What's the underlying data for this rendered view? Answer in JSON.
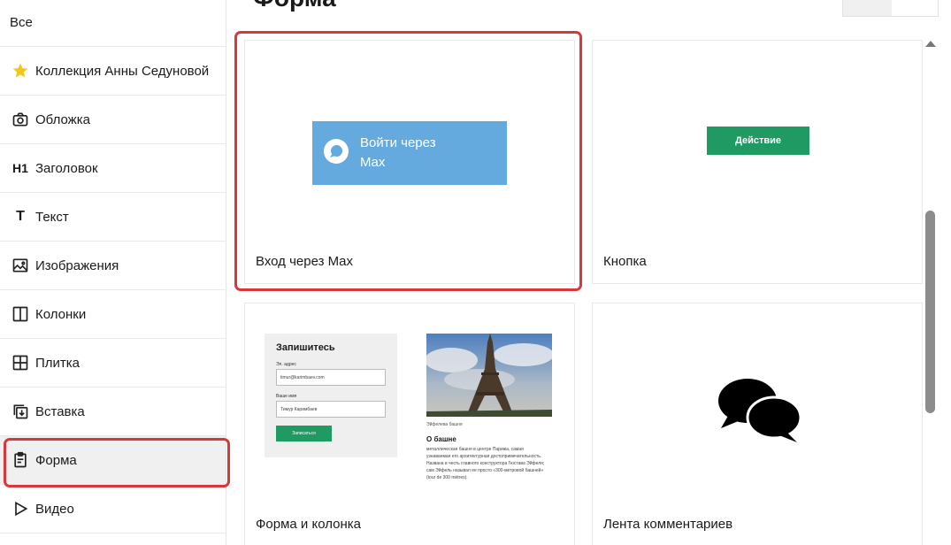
{
  "sidebar": {
    "items": [
      {
        "label": "Все",
        "icon": "none"
      },
      {
        "label": "Коллекция Анны Седуновой",
        "icon": "star-icon"
      },
      {
        "label": "Обложка",
        "icon": "camera-icon"
      },
      {
        "label": "Заголовок",
        "icon": "heading-h1-icon",
        "icon_text": "H1"
      },
      {
        "label": "Текст",
        "icon": "text-icon",
        "icon_text": "T"
      },
      {
        "label": "Изображения",
        "icon": "image-icon"
      },
      {
        "label": "Колонки",
        "icon": "columns-icon"
      },
      {
        "label": "Плитка",
        "icon": "grid-icon"
      },
      {
        "label": "Вставка",
        "icon": "embed-icon"
      },
      {
        "label": "Форма",
        "icon": "form-clipboard-icon"
      },
      {
        "label": "Видео",
        "icon": "play-icon"
      }
    ],
    "active_index": 9
  },
  "main": {
    "title": "Форма",
    "cards": [
      {
        "label": "Вход через Max",
        "preview_button_text_line1": "Войти через",
        "preview_button_text_line2": "Max"
      },
      {
        "label": "Кнопка",
        "preview_button_text": "Действие"
      },
      {
        "label": "Форма и колонка"
      },
      {
        "label": "Лента комментариев"
      }
    ]
  },
  "form_preview": {
    "title": "Запишитесь",
    "email_label": "Эл. адрес",
    "email_value": "timur@karimbaev.com",
    "name_label": "Ваше имя",
    "name_value": "Тимур Каримбаев",
    "submit": "Записаться",
    "photo_caption": "Эйфелева башня",
    "about_title": "О башне",
    "about_text": "металлическая башня в центре Парижа, самая узнаваемая его архитектурная достопримечательность. Названа в честь главного конструктора Гюстава Эйфеля; сам Эйфель называл ее просто «300-метровой башней» (tour de 300 mètres)."
  },
  "colors": {
    "accent_red": "#d9383a",
    "max_blue": "#64aadf",
    "action_green": "#1f9a63",
    "star_yellow": "#f5c518"
  }
}
